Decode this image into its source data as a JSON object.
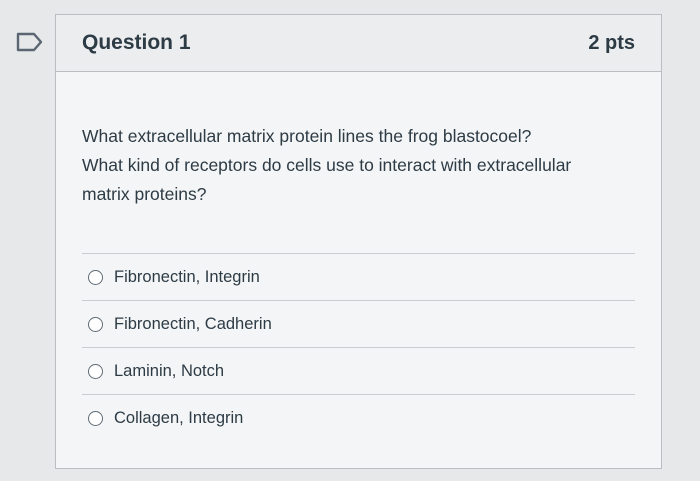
{
  "question": {
    "title": "Question 1",
    "points": "2 pts",
    "lines": [
      "What extracellular matrix protein lines the frog blastocoel?",
      "What kind of receptors do cells use to interact with extracellular",
      "matrix proteins?"
    ],
    "options": [
      {
        "label": "Fibronectin, Integrin",
        "selected": false
      },
      {
        "label": "Fibronectin, Cadherin",
        "selected": false
      },
      {
        "label": "Laminin, Notch",
        "selected": false
      },
      {
        "label": "Collagen, Integrin",
        "selected": false
      }
    ]
  },
  "icons": {
    "flag": "flag-icon"
  },
  "colors": {
    "text": "#2d3b45",
    "border": "#b9bec3",
    "header_bg": "#ebedef"
  }
}
